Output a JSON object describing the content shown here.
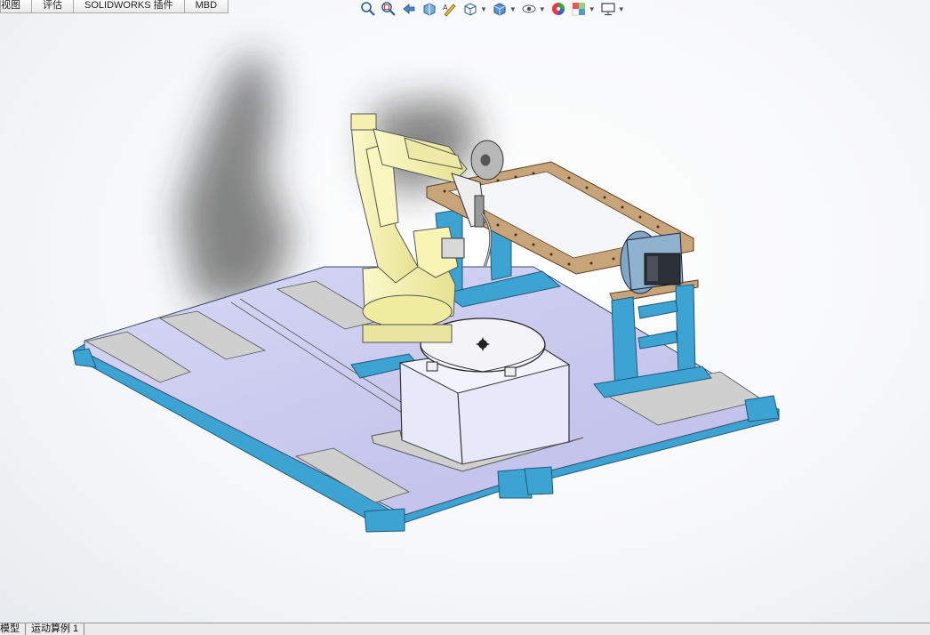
{
  "top_tabs": [
    "视图",
    "评估",
    "SOLIDWORKS 插件",
    "MBD"
  ],
  "bottom_tabs": [
    "模型",
    "运动算例 1"
  ],
  "toolbar": {
    "icons": [
      {
        "name": "zoom-to-fit-icon",
        "dropdown": false
      },
      {
        "name": "zoom-to-area-icon",
        "dropdown": false
      },
      {
        "name": "previous-view-icon",
        "dropdown": false
      },
      {
        "name": "section-view-icon",
        "dropdown": false
      },
      {
        "name": "dynamic-annotation-icon",
        "dropdown": false
      },
      {
        "name": "view-orientation-icon",
        "dropdown": true
      },
      {
        "name": "display-style-icon",
        "dropdown": true
      },
      {
        "name": "hide-show-items-icon",
        "dropdown": true
      },
      {
        "name": "edit-appearance-icon",
        "dropdown": false
      },
      {
        "name": "apply-scene-icon",
        "dropdown": true
      },
      {
        "name": "view-settings-icon",
        "dropdown": true
      }
    ]
  },
  "colors": {
    "frame_blue": "#3ca3d3",
    "floor_lavender": "#c8c8ef",
    "plate_grey": "#cfcfcf",
    "robot_yellow": "#f7f4b4",
    "table_lavender": "#e8e8fb",
    "bracket_bronze": "#c8a47a"
  }
}
